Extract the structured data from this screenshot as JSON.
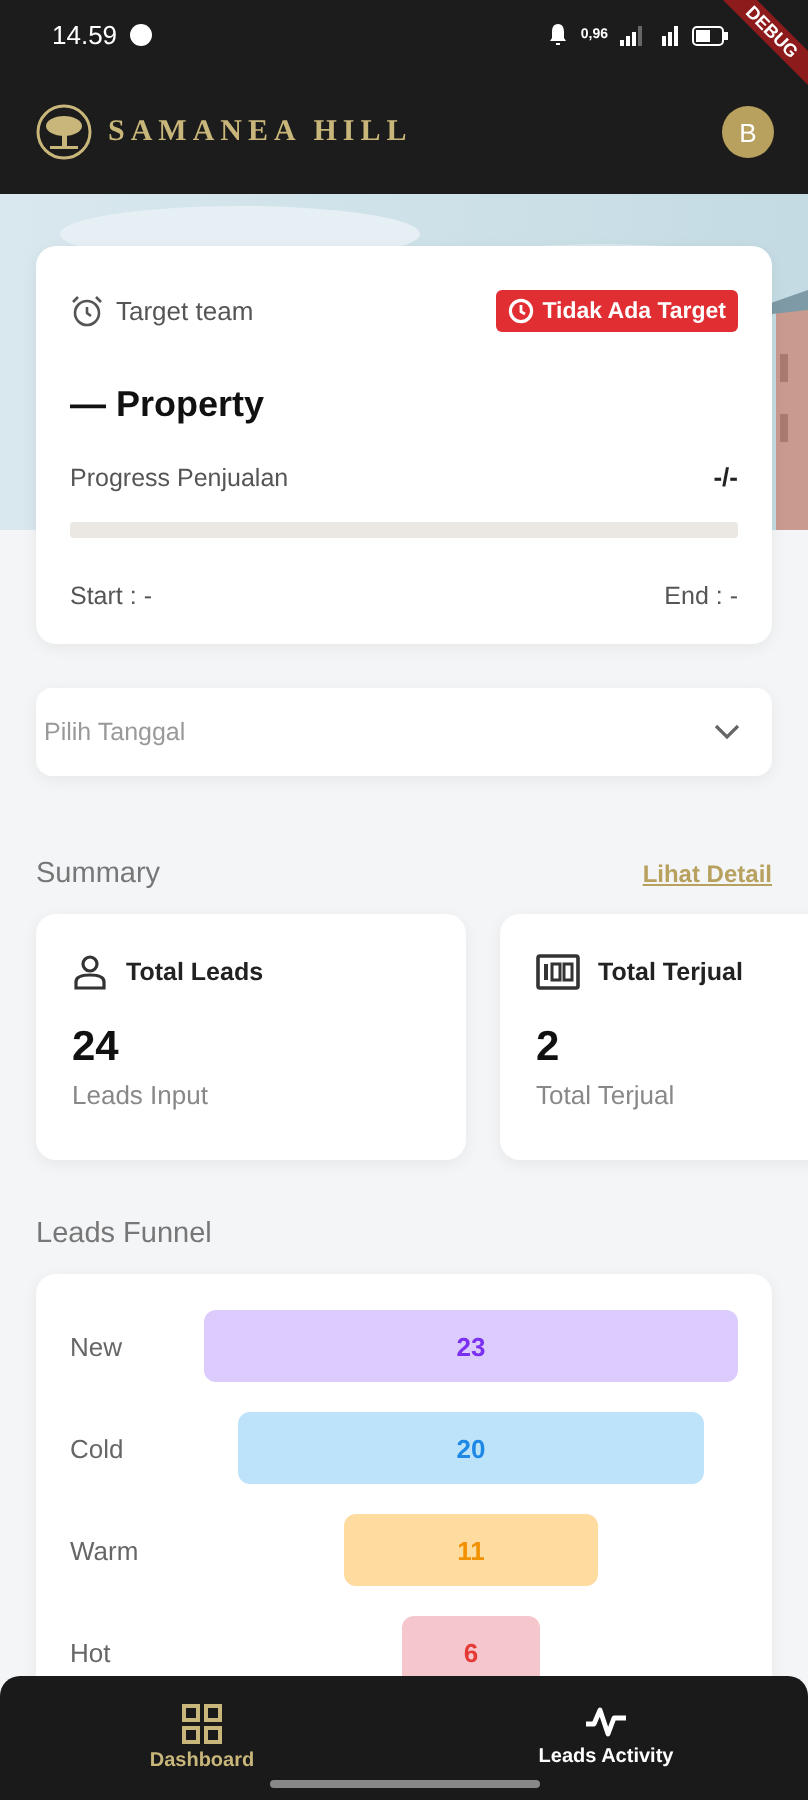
{
  "status_bar": {
    "time": "14.59",
    "net_speed": "0,96"
  },
  "debug_banner": "DEBUG",
  "app_bar": {
    "brand": "SAMANEA HILL",
    "avatar": "B"
  },
  "target_card": {
    "label": "Target team",
    "badge": "Tidak Ada Target",
    "title": "— Property",
    "progress_label": "Progress Penjualan",
    "progress_value": "-/-",
    "level": 0,
    "start": "Start : -",
    "end": "End : -"
  },
  "date_picker": {
    "placeholder": "Pilih Tanggal"
  },
  "summary": {
    "title": "Summary",
    "link": "Lihat Detail",
    "cards": [
      {
        "kind": "person",
        "title": "Total Leads",
        "value": "24",
        "caption": "Leads Input"
      },
      {
        "kind": "counter",
        "title": "Total Terjual",
        "value": "2",
        "caption": "Total Terjual"
      }
    ]
  },
  "funnel": {
    "title": "Leads Funnel",
    "stages": [
      {
        "label": "New",
        "value": "23",
        "color": "#dccbfd"
      },
      {
        "label": "Cold",
        "value": "20",
        "color": "#bde3fb"
      },
      {
        "label": "Warm",
        "value": "11",
        "color": "#fedb9e"
      },
      {
        "label": "Hot",
        "value": "6",
        "color": "#f5c6cb"
      }
    ]
  },
  "bottom_nav": [
    {
      "label": "Dashboard",
      "kind": "grid",
      "selected": true
    },
    {
      "label": "Leads Activity",
      "kind": "pulse",
      "selected": false
    }
  ]
}
